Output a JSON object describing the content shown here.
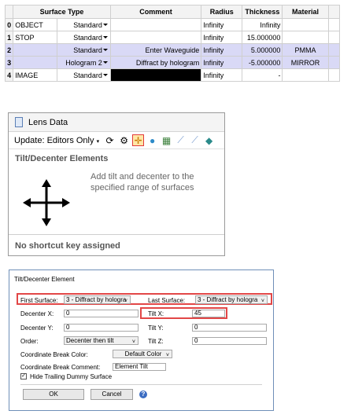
{
  "surface_table": {
    "headers": [
      "",
      "Surface Type",
      "",
      "Comment",
      "Radius",
      "Thickness",
      "Material"
    ],
    "rows": [
      {
        "num": "0",
        "name": "OBJECT",
        "type": "Standard",
        "comment": "",
        "radius": "Infinity",
        "thickness": "Infinity",
        "material": ""
      },
      {
        "num": "1",
        "name": "STOP",
        "type": "Standard",
        "comment": "",
        "radius": "Infinity",
        "thickness": "15.000000",
        "material": ""
      },
      {
        "num": "2",
        "name": "",
        "type": "Standard",
        "comment": "Enter Waveguide",
        "radius": "Infinity",
        "thickness": "5.000000",
        "material": "PMMA"
      },
      {
        "num": "3",
        "name": "",
        "type": "Hologram 2",
        "comment": "Diffract by hologram",
        "radius": "Infinity",
        "thickness": "-5.000000",
        "material": "MIRROR"
      },
      {
        "num": "4",
        "name": "IMAGE",
        "type": "Standard",
        "comment": "",
        "radius": "Infinity",
        "thickness": "-",
        "material": ""
      }
    ]
  },
  "lens_panel": {
    "title": "Lens Data",
    "toolbar_label": "Update: Editors Only",
    "tooltip_heading": "Tilt/Decenter Elements",
    "tooltip_desc": "Add tilt and decenter to the specified range of surfaces",
    "tooltip_footer": "No shortcut key assigned"
  },
  "dialog": {
    "title": "Tilt/Decenter Element",
    "first_surface_label": "First Surface:",
    "first_surface_value": "3 - Diffract by hologra",
    "last_surface_label": "Last Surface:",
    "last_surface_value": "3 - Diffract by hologra",
    "decenter_x_label": "Decenter X:",
    "decenter_x_value": "0",
    "tilt_x_label": "Tilt X:",
    "tilt_x_value": "45",
    "decenter_y_label": "Decenter Y:",
    "decenter_y_value": "0",
    "tilt_y_label": "Tilt Y:",
    "tilt_y_value": "0",
    "order_label": "Order:",
    "order_value": "Decenter then tilt",
    "tilt_z_label": "Tilt Z:",
    "tilt_z_value": "0",
    "cb_color_label": "Coordinate Break Color:",
    "cb_color_value": "Default Color",
    "cb_comment_label": "Coordinate Break Comment:",
    "cb_comment_value": "Element Tilt",
    "hide_trailing_label": "Hide Trailing Dummy Surface",
    "hide_trailing_checked": true,
    "ok_label": "OK",
    "cancel_label": "Cancel"
  },
  "colors": {
    "highlight_row": "#d9d9f6",
    "red_box": "#e24747",
    "active_icon_bg": "#ffe7a6"
  },
  "icons": [
    "document-icon",
    "refresh-icon",
    "settings-icon",
    "tilt-decenter-icon",
    "sphere-icon",
    "grid-icon",
    "ray-icon",
    "chevron-down-icon",
    "help-icon"
  ]
}
